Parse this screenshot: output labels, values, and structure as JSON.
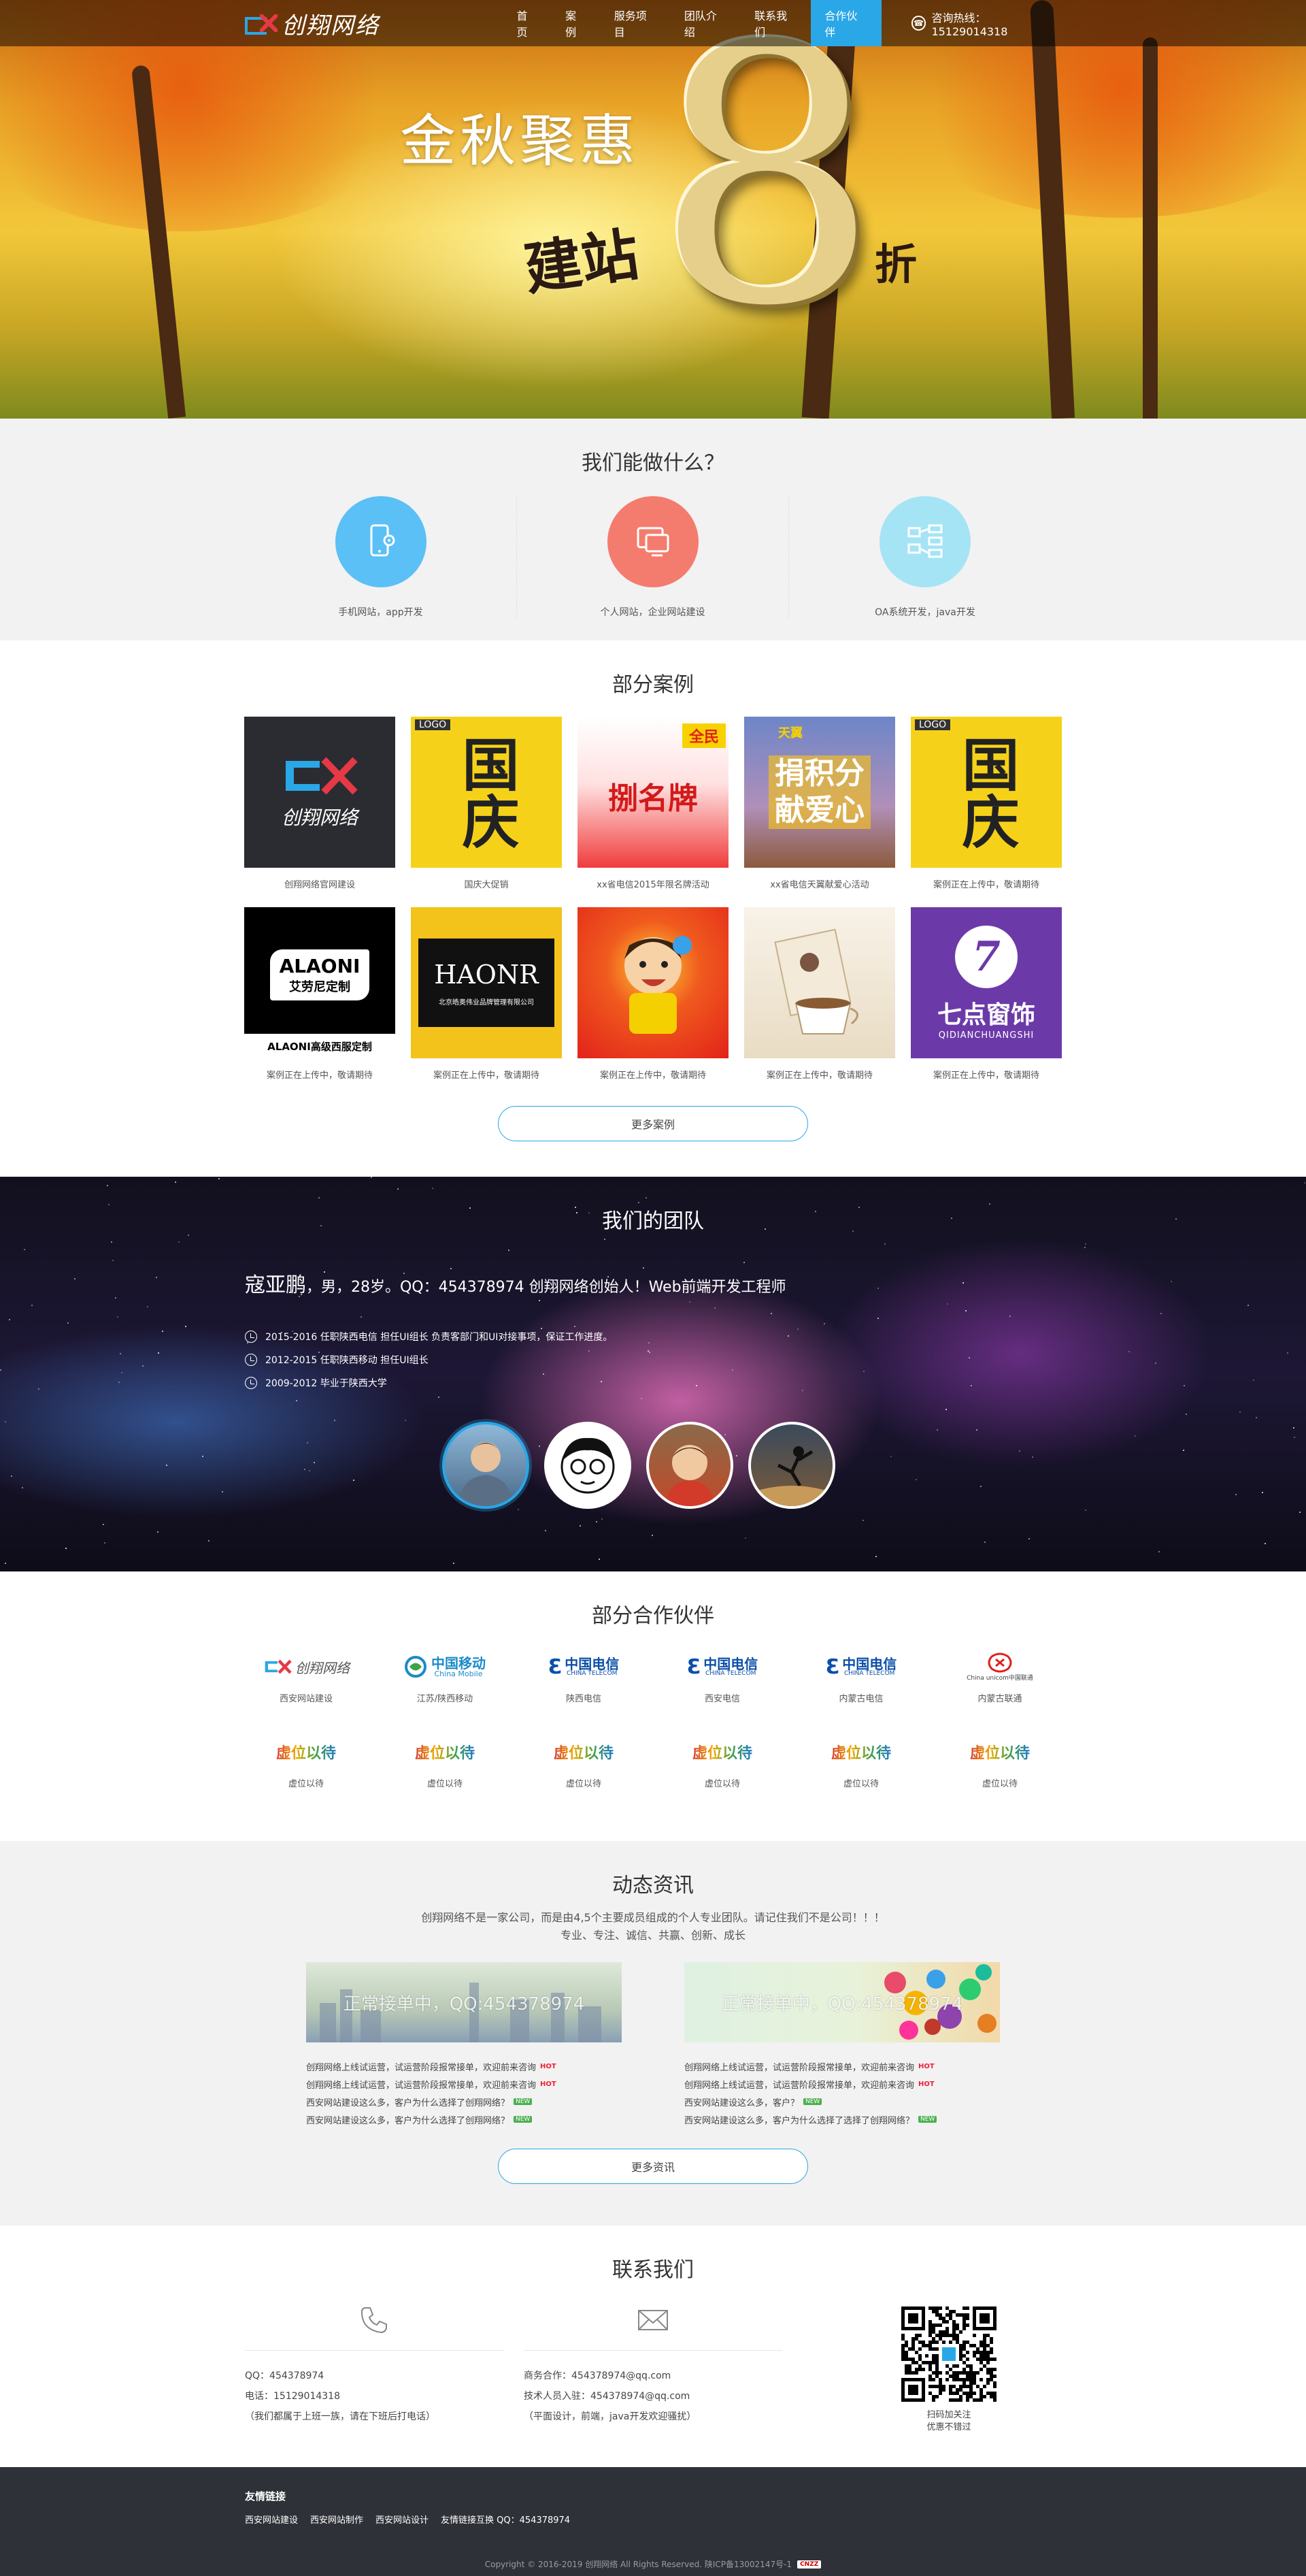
{
  "header": {
    "logo_text": "创翔网络",
    "nav": [
      {
        "label": "首页"
      },
      {
        "label": "案例"
      },
      {
        "label": "服务项目"
      },
      {
        "label": "团队介绍"
      },
      {
        "label": "联系我们"
      },
      {
        "label": "合作伙伴"
      }
    ],
    "active_nav": "合作伙伴",
    "hotline": "咨询热线：15129014318"
  },
  "banner": {
    "title": "金秋聚惠",
    "digit": "8",
    "prefix": "建站",
    "suffix": "折"
  },
  "services": {
    "title": "我们能做什么？",
    "items": [
      {
        "label": "手机网站，app开发",
        "icon": "mobile-gear-icon",
        "color": "#5bc0f5"
      },
      {
        "label": "个人网站，企业网站建设",
        "icon": "monitor-icon",
        "color": "#f47c6e"
      },
      {
        "label": "OA系统开发，java开发",
        "icon": "org-chart-icon",
        "color": "#a4e4f5"
      }
    ]
  },
  "cases": {
    "title": "部分案例",
    "items": [
      {
        "label": "创翔网络官网建设",
        "thumb_text": "创翔网络"
      },
      {
        "label": "国庆大促销",
        "thumb_text": "国庆"
      },
      {
        "label": "xx省电信2015年限名牌活动",
        "thumb_text": "捌名牌"
      },
      {
        "label": "xx省电信天翼献爱心活动",
        "thumb_text": "捐积分献爱心"
      },
      {
        "label": "案例正在上传中，敬请期待",
        "thumb_text": "国庆"
      },
      {
        "label": "案例正在上传中，敬请期待",
        "thumb_text": "ALAONI"
      },
      {
        "label": "案例正在上传中，敬请期待",
        "thumb_text": "HAONR"
      },
      {
        "label": "案例正在上传中，敬请期待",
        "thumb_text": ""
      },
      {
        "label": "案例正在上传中，敬请期待",
        "thumb_text": ""
      },
      {
        "label": "案例正在上传中，敬请期待",
        "thumb_text": "七点窗饰"
      }
    ],
    "thumb_sub": {
      "alaoni": "艾劳尼定制",
      "alaoni_caption": "ALAONI高级西服定制",
      "haonr": "北京皓奥伟业品牌管理有限公司",
      "qidian": "QIDIANCHUANGSHI",
      "logo": "LOGO",
      "quanmin": "全民",
      "tianyi": "天翼"
    },
    "more_label": "更多案例"
  },
  "team": {
    "title": "我们的团队",
    "name": "寇亚鹏",
    "headline": "，男，28岁。QQ：454378974 创翔网络创始人！Web前端开发工程师",
    "history": [
      "2015-2016 任职陕西电信 担任UI组长 负责客部门和UI对接事项，保证工作进度。",
      "2012-2015 任职陕西移动 担任UI组长",
      "2009-2012 毕业于陕西大学"
    ]
  },
  "partners": {
    "title": "部分合作伙伴",
    "items": [
      {
        "label": "西安网站建设",
        "logo_text": "创翔网络"
      },
      {
        "label": "江苏/陕西移动",
        "logo_text": "中国移动"
      },
      {
        "label": "陕西电信",
        "logo_text": "中国电信"
      },
      {
        "label": "西安电信",
        "logo_text": "中国电信"
      },
      {
        "label": "内蒙古电信",
        "logo_text": "中国电信"
      },
      {
        "label": "内蒙古联通",
        "logo_text": "China unicom中国联通"
      },
      {
        "label": "虚位以待",
        "logo_text": "虚位以待"
      },
      {
        "label": "虚位以待",
        "logo_text": "虚位以待"
      },
      {
        "label": "虚位以待",
        "logo_text": "虚位以待"
      },
      {
        "label": "虚位以待",
        "logo_text": "虚位以待"
      },
      {
        "label": "虚位以待",
        "logo_text": "虚位以待"
      },
      {
        "label": "虚位以待",
        "logo_text": "虚位以待"
      }
    ],
    "mobile_en": "China Mobile",
    "telecom_en": "CHINA TELECOM"
  },
  "news": {
    "title": "动态资讯",
    "subtitle_1": "创翔网络不是一家公司，而是由4,5个主要成员组成的个人专业团队。请记住我们不是公司！！！",
    "subtitle_2": "专业、专注、诚信、共赢、创新、成长",
    "cols": [
      {
        "banner": "正常接单中，QQ:454378974",
        "items": [
          {
            "text": "创翔网络上线试运营，试运营阶段报常接单，欢迎前来咨询",
            "tag": "HOT"
          },
          {
            "text": "创翔网络上线试运营，试运营阶段报常接单，欢迎前来咨询",
            "tag": "HOT"
          },
          {
            "text": "西安网站建设这么多，客户为什么选择了创翔网络？",
            "tag": "NEW"
          },
          {
            "text": "西安网站建设这么多，客户为什么选择了创翔网络？",
            "tag": "NEW"
          }
        ]
      },
      {
        "banner": "正常接单中，QQ:454378974",
        "items": [
          {
            "text": "创翔网络上线试运营，试运营阶段报常接单，欢迎前来咨询",
            "tag": "HOT"
          },
          {
            "text": "创翔网络上线试运营，试运营阶段报常接单，欢迎前来咨询",
            "tag": "HOT"
          },
          {
            "text": "西安网站建设这么多，客户？",
            "tag": "NEW"
          },
          {
            "text": "西安网站建设这么多，客户为什么选择了选择了创翔网络？",
            "tag": "NEW"
          }
        ]
      }
    ],
    "more_label": "更多资讯"
  },
  "contact": {
    "title": "联系我们",
    "col1": [
      "QQ：454378974",
      "电话：15129014318",
      "（我们都属于上班一族，请在下班后打电话）"
    ],
    "col2": [
      "商务合作：454378974@qq.com",
      "技术人员入驻：454378974@qq.com",
      "（平面设计，前端，java开发欢迎骚扰）"
    ],
    "qr_label_1": "扫码加关注",
    "qr_label_2": "优惠不错过"
  },
  "footer": {
    "friend_title": "友情链接",
    "links": [
      "西安网站建设",
      "西安网站制作",
      "西安网站设计",
      "友情链接互换 QQ：454378974"
    ],
    "copyright": "Copyright © 2016-2019 创翔网络 All Rights Reserved. 陕ICP备13002147号-1",
    "cnzz": "CNZZ"
  }
}
